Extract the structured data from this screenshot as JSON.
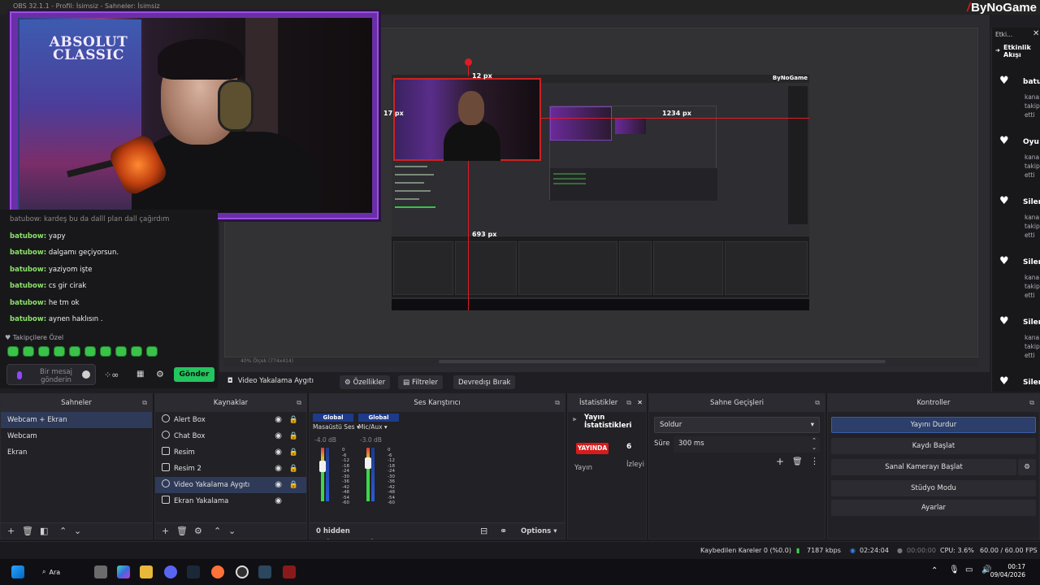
{
  "window": {
    "title": "OBS 32.1.1 - Profil: İsimsiz - Sahneler: İsimsiz",
    "brand_logo": "ByNoGame"
  },
  "preview": {
    "zoom_text": "40%  Ölçek (774x414)",
    "measurements": {
      "top": "12 px",
      "left": "17 px",
      "right": "1234 px",
      "bottom": "693 px"
    },
    "nested_logo": "ByNoGame"
  },
  "webcam": {
    "poster_text": "ABSOLUT CLASSIC"
  },
  "chat": {
    "partial_line": "batubow: kardeş bu da dalll plan dall çağırdım",
    "messages": [
      {
        "user": "batubow:",
        "text": "yapy"
      },
      {
        "user": "batubow:",
        "text": "dalgamı geçiyorsun."
      },
      {
        "user": "batubow:",
        "text": "yaziyom işte"
      },
      {
        "user": "batubow:",
        "text": "cs gir cirak"
      },
      {
        "user": "batubow:",
        "text": "he tm ok"
      },
      {
        "user": "batubow:",
        "text": "aynen haklısın ."
      }
    ],
    "followers_only": "Takipçilere Özel",
    "input_placeholder": "Bir mesaj gönderin",
    "send_label": "Gönder"
  },
  "feed": {
    "header": "Etki...",
    "title": "Etkinlik Akışı",
    "items": [
      {
        "name": "batu",
        "sub": "kana takip etti"
      },
      {
        "name": "Oyu",
        "sub": "kana takip etti"
      },
      {
        "name": "Siler",
        "sub": "kana takip etti"
      },
      {
        "name": "Siler",
        "sub": "kana takip etti"
      },
      {
        "name": "Siler",
        "sub": "kana takip etti"
      },
      {
        "name": "Siler",
        "sub": ""
      }
    ]
  },
  "source_toolbar": {
    "source_name": "Video Yakalama Aygıtı",
    "properties": "Özellikler",
    "filters": "Filtreler",
    "deactivate": "Devredışı Bırak"
  },
  "scenes": {
    "title": "Sahneler",
    "items": [
      "Webcam + Ekran",
      "Webcam",
      "Ekran"
    ]
  },
  "sources": {
    "title": "Kaynaklar",
    "items": [
      "Alert Box",
      "Chat Box",
      "Resim",
      "Resim 2",
      "Video Yakalama Aygıtı",
      "Ekran Yakalama"
    ]
  },
  "mixer": {
    "title": "Ses Karıştırıcı",
    "channels": [
      {
        "label": "Global",
        "name": "Masaüstü Ses",
        "db": "-4.0 dB"
      },
      {
        "label": "Global",
        "name": "Mic/Aux",
        "db": "-3.0 dB"
      }
    ],
    "scale": [
      "0",
      "-6",
      "-12",
      "-18",
      "-24",
      "-30",
      "-36",
      "-42",
      "-48",
      "-54",
      "-60"
    ],
    "hidden": "0 hidden",
    "options": "Options"
  },
  "stats": {
    "title": "İstatistikler",
    "heading": "Yayın İstatistikleri",
    "live": "YAYINDA",
    "count": "6",
    "stream": "Yayın",
    "viewers": "İzleyi"
  },
  "transitions": {
    "title": "Sahne Geçişleri",
    "type": "Soldur",
    "duration_label": "Süre",
    "duration": "300 ms"
  },
  "controls": {
    "title": "Kontroller",
    "buttons": [
      "Yayını Durdur",
      "Kaydı Başlat",
      "Sanal Kamerayı Başlat",
      "Stüdyo Modu",
      "Ayarlar"
    ]
  },
  "status": {
    "dropped": "Kaybedilen Kareler 0 (%0.0)",
    "bitrate": "7187 kbps",
    "stream_time": "02:24:04",
    "rec_time": "00:00:00",
    "cpu": "CPU: 3.6%",
    "fps": "60.00 / 60.00 FPS"
  },
  "taskbar": {
    "search": "Ara",
    "time": "00:17",
    "date": "09/04/2026"
  },
  "colors": {
    "accent": "#9147ff",
    "live": "#d81b1b",
    "send": "#22c55e",
    "selection": "#2e3a58"
  }
}
